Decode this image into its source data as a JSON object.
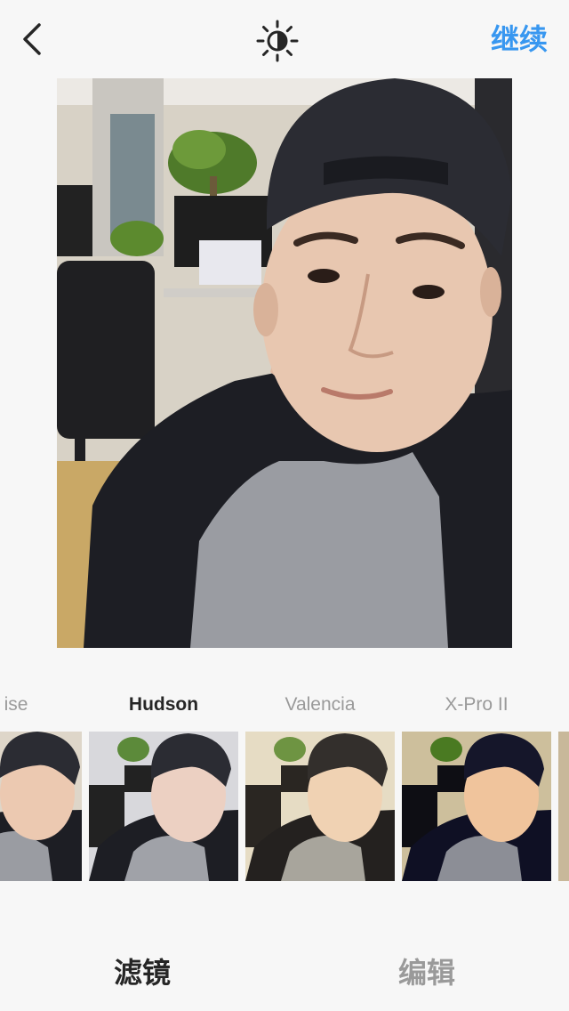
{
  "header": {
    "back_icon": "chevron-left-icon",
    "lux_icon": "lux-brightness-icon",
    "next_label": "继续",
    "accent_color": "#3897f0"
  },
  "photo": {
    "subject": "selfie"
  },
  "filters": {
    "names": [
      "ise",
      "Hudson",
      "Valencia",
      "X-Pro II"
    ],
    "active": "Hudson"
  },
  "tabs": {
    "filter_label": "滤镜",
    "edit_label": "编辑",
    "active": "滤镜"
  }
}
